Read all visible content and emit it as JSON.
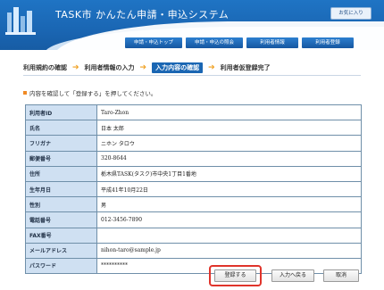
{
  "header": {
    "app_title": "TASK市 かんたん申請・申込システム",
    "favorite_label": "お気に入り",
    "nav": [
      "申請・申込トップ",
      "申請・申込の照会",
      "利用者情報",
      "利用者登録"
    ]
  },
  "steps": {
    "items": [
      "利用規約の確認",
      "利用者情報の入力",
      "入力内容の確認",
      "利用者仮登録完了"
    ],
    "active_index": 2
  },
  "instruction": "内容を確認して「登録する」を押してください。",
  "form": {
    "rows": [
      {
        "label": "利用者ID",
        "value": "Taro-Zhon"
      },
      {
        "label": "氏名",
        "value": "日本 太郎"
      },
      {
        "label": "フリガナ",
        "value": "ニホン タロウ"
      },
      {
        "label": "郵便番号",
        "value": "320-8644"
      },
      {
        "label": "住所",
        "value": "栃木県TASK(タスク)市中央1丁目1番地"
      },
      {
        "label": "生年月日",
        "value": "平成41年10月22日"
      },
      {
        "label": "性別",
        "value": "男"
      },
      {
        "label": "電話番号",
        "value": "012-3456-7890"
      },
      {
        "label": "FAX番号",
        "value": ""
      },
      {
        "label": "メールアドレス",
        "value": "nihon-taro@sample.jp"
      },
      {
        "label": "パスワード",
        "value": "**********"
      }
    ]
  },
  "buttons": {
    "register": "登録する",
    "back": "入力へ戻る",
    "cancel": "取消"
  },
  "colors": {
    "header_blue": "#1a66b3",
    "step_arrow": "#f0a020",
    "highlight_border": "#e0342b",
    "label_bg": "#cfe0f2"
  }
}
